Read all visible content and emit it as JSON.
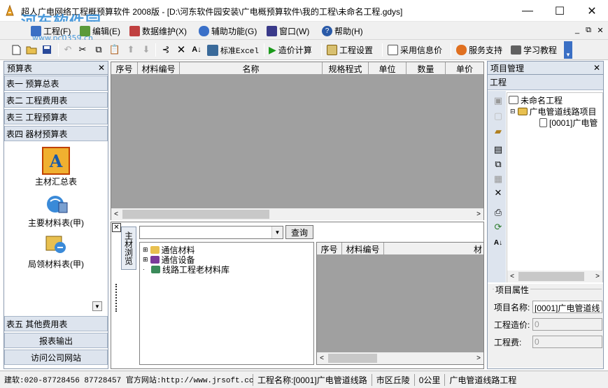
{
  "window": {
    "title": "超人广电网络工程概预算软件 2008版 - [D:\\河东软件园安装\\广电概预算软件\\我的工程\\未命名工程.gdys]",
    "watermark": "河东软件园",
    "watermark_url": "www.pc0359.cn",
    "minimize": "—",
    "maximize": "☐",
    "close": "✕"
  },
  "menu": {
    "items": [
      {
        "label": "工程(F)"
      },
      {
        "label": "编辑(E)"
      },
      {
        "label": "数据维护(X)"
      },
      {
        "label": "辅助功能(G)"
      },
      {
        "label": "窗口(W)"
      },
      {
        "label": "帮助(H)"
      }
    ],
    "mdi_min": "_",
    "mdi_restore": "⧉",
    "mdi_close": "✕"
  },
  "toolbar": {
    "excel_label": "标准Excel",
    "calc_label": "造价计算",
    "settings_label": "工程设置",
    "info_price_label": "采用信息价",
    "service_label": "服务支持",
    "tutorial_label": "学习教程"
  },
  "left_panel": {
    "title": "预算表",
    "close": "✕",
    "tables": [
      "表一 预算总表",
      "表二 工程费用表",
      "表三 工程预算表",
      "表四 器材预算表"
    ],
    "icons": [
      {
        "label": "主材汇总表",
        "icon": "summary-icon"
      },
      {
        "label": "主要材料表(甲)",
        "icon": "materials-icon"
      },
      {
        "label": "局领材料表(甲)",
        "icon": "bureau-materials-icon"
      }
    ],
    "bottom_buttons": [
      "表五 其他费用表",
      "报表输出",
      "访问公司网站"
    ]
  },
  "main_grid": {
    "columns": [
      "序号",
      "材料编号",
      "名称",
      "规格程式",
      "单位",
      "数量",
      "单价"
    ]
  },
  "material_browser": {
    "tab_label": "主材浏览",
    "search_placeholder": "",
    "query_button": "查询",
    "tree": [
      "通信材料",
      "通信设备",
      "线路工程老材料库"
    ],
    "columns": [
      "序号",
      "材料编号",
      "材"
    ]
  },
  "project_panel": {
    "title": "项目管理",
    "close": "✕",
    "tab": "工程",
    "tree": {
      "root": "未命名工程",
      "child": "广电管道线路项目",
      "leaf": "[0001]广电管"
    }
  },
  "properties": {
    "title": "项目属性",
    "name_label": "项目名称:",
    "name_value": "[0001]广电管道线",
    "cost_label": "工程造价:",
    "cost_value": "0",
    "fee_label": "工程费:",
    "fee_value": "0"
  },
  "status": {
    "contact": "建软:020-87728456 87728457 官方网站:http://www.jrsoft.cc",
    "project": "工程名称:[0001]广电管道线路",
    "region": "市区丘陵",
    "length": "0公里",
    "type": "广电管道线路工程"
  }
}
